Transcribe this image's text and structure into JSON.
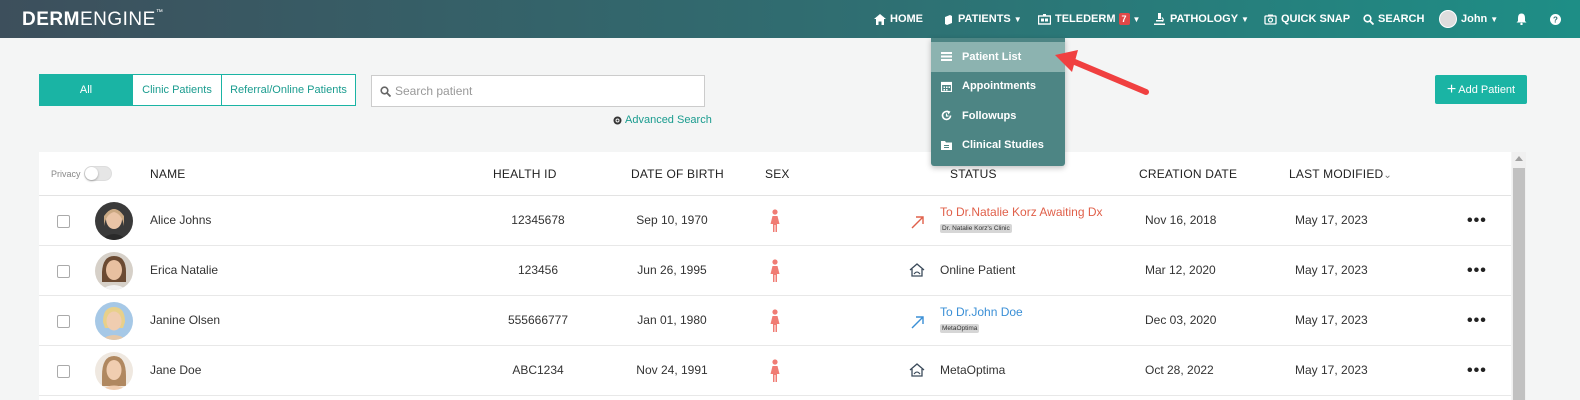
{
  "brand": {
    "name_bold": "DERM",
    "name_light": "ENGINE",
    "tm": "™"
  },
  "nav": {
    "home": "HOME",
    "patients": "PATIENTS",
    "telederm": "TELEDERM",
    "telederm_badge": "7",
    "pathology": "PATHOLOGY",
    "quick_snap": "QUICK SNAP",
    "search": "SEARCH",
    "user": "John"
  },
  "patients_menu": {
    "items": [
      {
        "label": "Patient List",
        "icon": "list-icon"
      },
      {
        "label": "Appointments",
        "icon": "calendar-icon"
      },
      {
        "label": "Followups",
        "icon": "refresh-icon"
      },
      {
        "label": "Clinical Studies",
        "icon": "folder-icon"
      }
    ]
  },
  "filters": {
    "all": "All",
    "clinic": "Clinic Patients",
    "referral": "Referral/Online Patients"
  },
  "search": {
    "placeholder": "Search patient",
    "advanced": "Advanced Search"
  },
  "add_patient": "Add Patient",
  "table": {
    "privacy_label": "Privacy",
    "headers": {
      "name": "NAME",
      "health_id": "HEALTH ID",
      "dob": "DATE OF BIRTH",
      "sex": "SEX",
      "status": "STATUS",
      "created": "CREATION DATE",
      "modified": "LAST MODIFIED",
      "sort_caret": "⌄"
    },
    "rows": [
      {
        "name": "Alice Johns",
        "health_id": "12345678",
        "dob": "Sep 10, 1970",
        "status": "To Dr.Natalie Korz Awaiting Dx",
        "status_tag": "Dr. Natalie Korz's Clinic",
        "created": "Nov 16, 2018",
        "modified": "May 17, 2023"
      },
      {
        "name": "Erica Natalie",
        "health_id": "123456",
        "dob": "Jun 26, 1995",
        "status": "Online Patient",
        "created": "Mar 12, 2020",
        "modified": "May 17, 2023"
      },
      {
        "name": "Janine Olsen",
        "health_id": "555666777",
        "dob": "Jan 01, 1980",
        "status": "To Dr.John Doe",
        "status_tag": "MetaOptima",
        "created": "Dec 03, 2020",
        "modified": "May 17, 2023"
      },
      {
        "name": "Jane Doe",
        "health_id": "ABC1234",
        "dob": "Nov 24, 1991",
        "status": "MetaOptima",
        "created": "Oct 28, 2022",
        "modified": "May 17, 2023"
      }
    ],
    "more": "•••"
  },
  "colors": {
    "accent": "#1ab4a4",
    "status_red": "#e0604a",
    "status_blue": "#3a8fd6",
    "female": "#f07c74"
  }
}
